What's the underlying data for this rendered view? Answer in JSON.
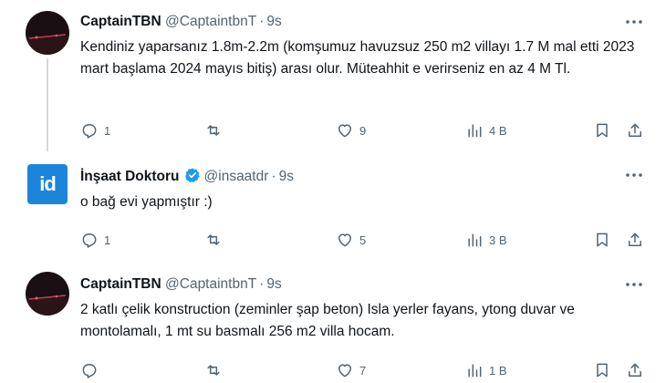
{
  "tweets": [
    {
      "name": "CaptainTBN",
      "handle": "@CaptaintbnT",
      "time": "9s",
      "verified": false,
      "avatar_icon": "dark-night-photo-avatar",
      "text": "Kendiniz yaparsanız  1.8m-2.2m (komşumuz havuzsuz 250 m2 villayı 1.7 M mal etti  2023 mart başlama 2024 mayıs bitiş) arası olur. Müteahhit e verirseniz en az 4 M Tl.",
      "replies": "1",
      "retweets": "",
      "likes": "9",
      "views": "4 B"
    },
    {
      "name": "İnşaat Doktoru",
      "handle": "@insaatdr",
      "time": "9s",
      "verified": true,
      "avatar_text": "id",
      "avatar_icon": "id-logo-avatar",
      "text": "o bağ evi yapmıştır :)",
      "replies": "1",
      "retweets": "",
      "likes": "5",
      "views": "3 B"
    },
    {
      "name": "CaptainTBN",
      "handle": "@CaptaintbnT",
      "time": "9s",
      "verified": false,
      "avatar_icon": "dark-night-photo-avatar",
      "text": "2 katlı çelik konstruction (zeminler şap beton) Isla yerler fayans, ytong duvar ve montolamalı, 1 mt su basmalı 256 m2 villa hocam.",
      "replies": "",
      "retweets": "",
      "likes": "7",
      "views": "1 B"
    }
  ],
  "separator": "·",
  "colors": {
    "verified_blue": "#1d9bf0",
    "muted": "#536471",
    "id_logo_blue": "#1d85d9"
  },
  "icons": [
    "reply-icon",
    "retweet-icon",
    "like-icon",
    "views-icon",
    "bookmark-icon",
    "share-icon",
    "more-icon",
    "verified-badge-icon"
  ]
}
